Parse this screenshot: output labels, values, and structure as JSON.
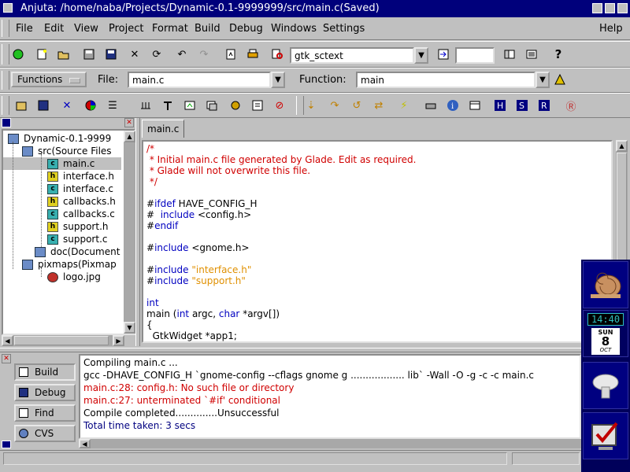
{
  "window": {
    "title": "Anjuta: /home/naba/Projects/Dynamic-0.1-9999999/src/main.c(Saved)"
  },
  "menu": [
    {
      "label": "File"
    },
    {
      "label": "Edit"
    },
    {
      "label": "View"
    },
    {
      "label": "Project"
    },
    {
      "label": "Format"
    },
    {
      "label": "Build"
    },
    {
      "label": "Debug"
    },
    {
      "label": "Windows"
    },
    {
      "label": "Settings"
    },
    {
      "label": "Help"
    }
  ],
  "toolbar": {
    "search_value": "gtk_sctext",
    "goto_line_value": ""
  },
  "browser_bar": {
    "mode_label": "Functions",
    "file_label": "File:",
    "file_value": "main.c",
    "function_label": "Function:",
    "function_value": "main"
  },
  "project_tree": [
    {
      "label": "Dynamic-0.1-9999",
      "icon": "folder-icon",
      "level": 0
    },
    {
      "label": "src(Source Files",
      "icon": "folder-icon",
      "level": 1
    },
    {
      "label": "main.c",
      "icon": "c-file-icon",
      "level": 2,
      "selected": true
    },
    {
      "label": "interface.h",
      "icon": "h-file-icon",
      "level": 2
    },
    {
      "label": "interface.c",
      "icon": "c-file-icon",
      "level": 2
    },
    {
      "label": "callbacks.h",
      "icon": "h-file-icon",
      "level": 2
    },
    {
      "label": "callbacks.c",
      "icon": "c-file-icon",
      "level": 2
    },
    {
      "label": "support.h",
      "icon": "h-file-icon",
      "level": 2
    },
    {
      "label": "support.c",
      "icon": "c-file-icon",
      "level": 2
    },
    {
      "label": "doc(Document F",
      "icon": "folder-icon",
      "level": 1
    },
    {
      "label": "pixmaps(Pixmap",
      "icon": "folder-icon",
      "level": 1
    },
    {
      "label": "logo.jpg",
      "icon": "image-file-icon",
      "level": 2
    }
  ],
  "editor": {
    "tab_label": "main.c",
    "lines": [
      [
        {
          "t": "/*",
          "c": "comment"
        }
      ],
      [
        {
          "t": " * Initial main.c file generated by Glade. Edit as required.",
          "c": "comment"
        }
      ],
      [
        {
          "t": " * Glade will not overwrite this file.",
          "c": "comment"
        }
      ],
      [
        {
          "t": " */",
          "c": "comment"
        }
      ],
      [
        {
          "t": "",
          "c": "plain"
        }
      ],
      [
        {
          "t": "#",
          "c": "plain"
        },
        {
          "t": "ifdef",
          "c": "kw"
        },
        {
          "t": " HAVE_CONFIG_H",
          "c": "plain"
        }
      ],
      [
        {
          "t": "#  ",
          "c": "plain"
        },
        {
          "t": "include",
          "c": "kw"
        },
        {
          "t": " <config.h>",
          "c": "plain"
        }
      ],
      [
        {
          "t": "#",
          "c": "plain"
        },
        {
          "t": "endif",
          "c": "kw"
        }
      ],
      [
        {
          "t": "",
          "c": "plain"
        }
      ],
      [
        {
          "t": "#",
          "c": "plain"
        },
        {
          "t": "include",
          "c": "kw"
        },
        {
          "t": " <gnome.h>",
          "c": "plain"
        }
      ],
      [
        {
          "t": "",
          "c": "plain"
        }
      ],
      [
        {
          "t": "#",
          "c": "plain"
        },
        {
          "t": "include",
          "c": "kw"
        },
        {
          "t": " \"interface.h\"",
          "c": "str"
        }
      ],
      [
        {
          "t": "#",
          "c": "plain"
        },
        {
          "t": "include",
          "c": "kw"
        },
        {
          "t": " \"support.h\"",
          "c": "str"
        }
      ],
      [
        {
          "t": "",
          "c": "plain"
        }
      ],
      [
        {
          "t": "int",
          "c": "kw"
        }
      ],
      [
        {
          "t": "main (",
          "c": "plain"
        },
        {
          "t": "int",
          "c": "kw"
        },
        {
          "t": " argc, ",
          "c": "plain"
        },
        {
          "t": "char",
          "c": "kw"
        },
        {
          "t": " *argv[])",
          "c": "plain"
        }
      ],
      [
        {
          "t": "{",
          "c": "plain"
        }
      ],
      [
        {
          "t": "  GtkWidget *app1;",
          "c": "plain"
        }
      ]
    ]
  },
  "messages": {
    "tabs": [
      {
        "label": "Build",
        "active": true
      },
      {
        "label": "Debug"
      },
      {
        "label": "Find"
      },
      {
        "label": "CVS"
      }
    ],
    "lines": [
      {
        "text": "Compiling main.c ...",
        "color": "#000000"
      },
      {
        "text": "gcc -DHAVE_CONFIG_H `gnome-config --cflags gnome g .................. lib` -Wall -O -g  -c -c main.c",
        "color": "#000000"
      },
      {
        "text": "main.c:28: config.h: No such file or directory",
        "color": "#d00000"
      },
      {
        "text": "main.c:27: unterminated `#if' conditional",
        "color": "#d00000"
      },
      {
        "text": "Compile completed..............Unsuccessful",
        "color": "#000000"
      },
      {
        "text": "Total time taken: 3 secs",
        "color": "#000080"
      }
    ]
  },
  "dock": {
    "clock_time": "14:40",
    "calendar_day": "SUN",
    "calendar_date": "8",
    "calendar_month": "OCT"
  },
  "colors": {
    "titlebar": "#00007b",
    "comment": "#d00000",
    "keyword": "#0000c0",
    "string": "#e09000",
    "selection": "#c0c0c0"
  }
}
